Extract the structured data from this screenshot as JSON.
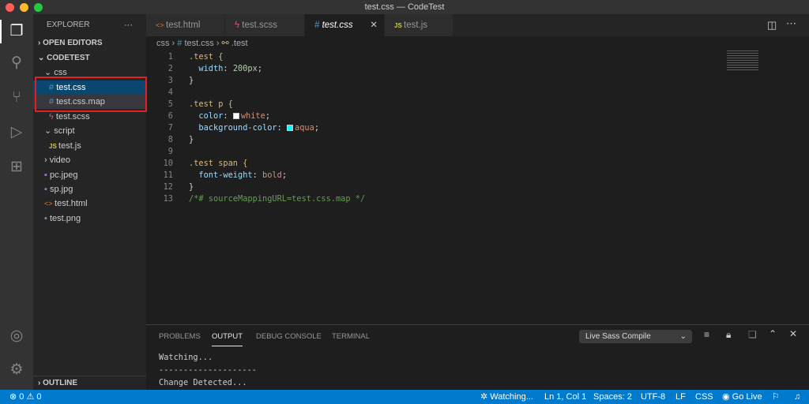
{
  "window": {
    "title": "test.css — CodeTest"
  },
  "sidebar": {
    "title": "EXPLORER",
    "more": "···",
    "open_editors": "OPEN EDITORS",
    "project": "CODETEST",
    "outline": "OUTLINE",
    "items": [
      {
        "label": "css",
        "kind": "folder",
        "icon": "chevron-down"
      },
      {
        "label": "test.css",
        "kind": "css",
        "icon": "#"
      },
      {
        "label": "test.css.map",
        "kind": "css",
        "icon": "#"
      },
      {
        "label": "test.scss",
        "kind": "scss",
        "icon": "sass"
      },
      {
        "label": "script",
        "kind": "folder",
        "icon": "chevron-down"
      },
      {
        "label": "test.js",
        "kind": "js",
        "icon": "JS"
      },
      {
        "label": "video",
        "kind": "folder",
        "icon": "chevron-right"
      },
      {
        "label": "pc.jpeg",
        "kind": "image"
      },
      {
        "label": "sp.jpg",
        "kind": "image"
      },
      {
        "label": "test.html",
        "kind": "html",
        "icon": "<>"
      },
      {
        "label": "test.png",
        "kind": "image"
      }
    ]
  },
  "tabs": [
    {
      "label": "test.html",
      "icon": "<>"
    },
    {
      "label": "test.scss",
      "icon": "sass"
    },
    {
      "label": "test.css",
      "icon": "#",
      "active": true
    },
    {
      "label": "test.js",
      "icon": "JS"
    }
  ],
  "breadcrumb": {
    "folder": "css",
    "file": "test.css",
    "symbol": ".test"
  },
  "code": {
    "line_numbers": [
      "1",
      "2",
      "3",
      "4",
      "5",
      "6",
      "7",
      "8",
      "9",
      "10",
      "11",
      "12",
      "13"
    ],
    "l1": ".test {",
    "l2p": "width",
    "l2v": "200px",
    "l5": ".test p {",
    "l6p": "color",
    "l6v": "white",
    "l7p": "background-color",
    "l7v": "aqua",
    "l10": ".test span {",
    "l11p": "font-weight",
    "l11v": "bold",
    "l13": "/*# sourceMappingURL=test.css.map */",
    "swatch_white": "#ffffff",
    "swatch_aqua": "#00ffff"
  },
  "panel": {
    "tabs": [
      "PROBLEMS",
      "OUTPUT",
      "DEBUG CONSOLE",
      "TERMINAL"
    ],
    "active_tab": "OUTPUT",
    "channel": "Live Sass Compile",
    "output": [
      "Watching...",
      "--------------------",
      "Change Detected..."
    ]
  },
  "status": {
    "errors": "0",
    "warnings": "0",
    "watching": "Watching...",
    "position": "Ln 1, Col 1",
    "spaces": "Spaces: 2",
    "encoding": "UTF-8",
    "eol": "LF",
    "language": "CSS",
    "golive": "Go Live"
  },
  "colors": {
    "accent": "#007acc",
    "selection": "#094771",
    "highlight_box": "#e51e25"
  }
}
